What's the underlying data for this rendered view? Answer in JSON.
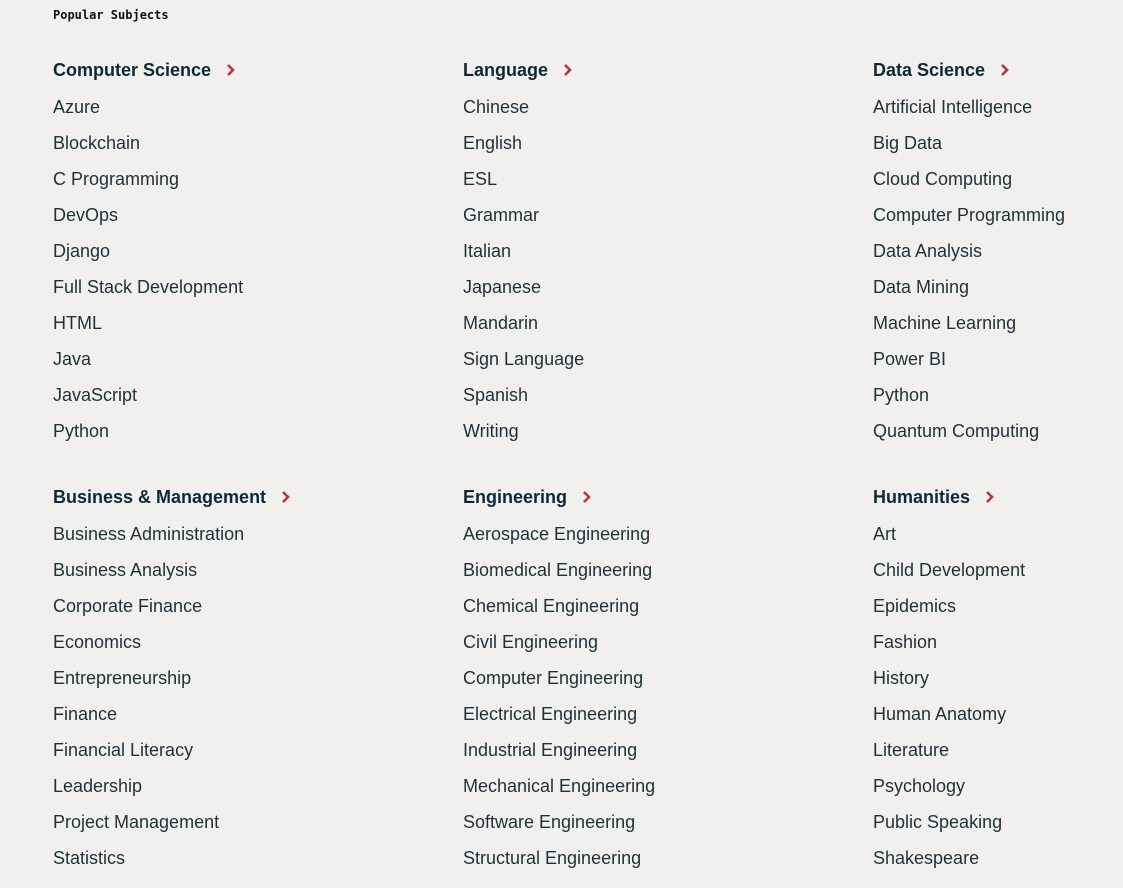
{
  "page_label": "Popular Subjects",
  "accent_color": "#b33a36",
  "groups": [
    {
      "title": "Computer Science",
      "items": [
        "Azure",
        "Blockchain",
        "C Programming",
        "DevOps",
        "Django",
        "Full Stack Development",
        "HTML",
        "Java",
        "JavaScript",
        "Python"
      ]
    },
    {
      "title": "Language",
      "items": [
        "Chinese",
        "English",
        "ESL",
        "Grammar",
        "Italian",
        "Japanese",
        "Mandarin",
        "Sign Language",
        "Spanish",
        "Writing"
      ]
    },
    {
      "title": "Data Science",
      "items": [
        "Artificial Intelligence",
        "Big Data",
        "Cloud Computing",
        "Computer Programming",
        "Data Analysis",
        "Data Mining",
        "Machine Learning",
        "Power BI",
        "Python",
        "Quantum Computing"
      ]
    },
    {
      "title": "Business & Management",
      "items": [
        "Business Administration",
        "Business Analysis",
        "Corporate Finance",
        "Economics",
        "Entrepreneurship",
        "Finance",
        "Financial Literacy",
        "Leadership",
        "Project Management",
        "Statistics"
      ]
    },
    {
      "title": "Engineering",
      "items": [
        "Aerospace Engineering",
        "Biomedical Engineering",
        "Chemical Engineering",
        "Civil Engineering",
        "Computer Engineering",
        "Electrical Engineering",
        "Industrial Engineering",
        "Mechanical Engineering",
        "Software Engineering",
        "Structural Engineering"
      ]
    },
    {
      "title": "Humanities",
      "items": [
        "Art",
        "Child Development",
        "Epidemics",
        "Fashion",
        "History",
        "Human Anatomy",
        "Literature",
        "Psychology",
        "Public Speaking",
        "Shakespeare"
      ]
    }
  ]
}
